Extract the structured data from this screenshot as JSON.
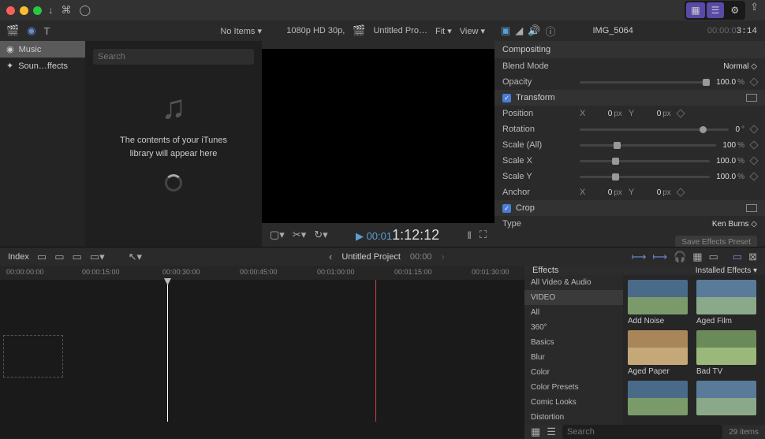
{
  "window": {
    "title": "IMG_5064",
    "timecode": "00:00:03:14"
  },
  "toolbar": {
    "no_items": "No Items ▾",
    "format": "1080p HD 30p,",
    "project": "Untitled Pro…",
    "fit": "Fit ▾",
    "view": "View ▾"
  },
  "sidebar": {
    "items": [
      {
        "label": "Music",
        "icon": "music-icon"
      },
      {
        "label": "Soun…ffects",
        "icon": "sparkle-icon"
      }
    ]
  },
  "browser": {
    "search_ph": "Search",
    "msg_l1": "The contents of your iTunes",
    "msg_l2": "library will appear here"
  },
  "viewer": {
    "timecode_prefix": "▶ 00:01",
    "timecode_main": "1:12:12"
  },
  "inspector": {
    "compositing": "Compositing",
    "blend": {
      "label": "Blend Mode",
      "value": "Normal ◇"
    },
    "opacity": {
      "label": "Opacity",
      "value": "100.0",
      "unit": "%"
    },
    "transform": "Transform",
    "position": {
      "label": "Position",
      "x": "0",
      "y": "0",
      "unit": "px"
    },
    "rotation": {
      "label": "Rotation",
      "value": "0",
      "unit": "°"
    },
    "scale_all": {
      "label": "Scale (All)",
      "value": "100",
      "unit": "%"
    },
    "scale_x": {
      "label": "Scale X",
      "value": "100.0",
      "unit": "%"
    },
    "scale_y": {
      "label": "Scale Y",
      "value": "100.0",
      "unit": "%"
    },
    "anchor": {
      "label": "Anchor",
      "x": "0",
      "y": "0",
      "unit": "px"
    },
    "crop": "Crop",
    "type": {
      "label": "Type",
      "value": "Ken Burns ◇"
    },
    "save": "Save Effects Preset"
  },
  "timeline": {
    "index": "Index",
    "project": "Untitled Project",
    "tc": "00:00",
    "ticks": [
      "00:00:00:00",
      "00:00:15:00",
      "00:00:30:00",
      "00:00:45:00",
      "00:01:00:00",
      "00:01:15:00",
      "00:01:30:00"
    ]
  },
  "effects": {
    "title": "Effects",
    "installed": "Installed Effects ▾",
    "cats": [
      "All Video & Audio",
      "VIDEO",
      "All",
      "360°",
      "Basics",
      "Blur",
      "Color",
      "Color Presets",
      "Comic Looks",
      "Distortion"
    ],
    "items": [
      {
        "name": "Add Noise",
        "c1": "#4a6a8a",
        "c2": "#7a9a6a"
      },
      {
        "name": "Aged Film",
        "c1": "#5a7a9a",
        "c2": "#8aa88a"
      },
      {
        "name": "Aged Paper",
        "c1": "#a8865a",
        "c2": "#c4a878"
      },
      {
        "name": "Bad TV",
        "c1": "#6a8a5a",
        "c2": "#9ab87a"
      },
      {
        "name": "",
        "c1": "#4a6a8a",
        "c2": "#7a9a6a"
      },
      {
        "name": "",
        "c1": "#5a7a9a",
        "c2": "#8aa88a"
      }
    ],
    "search_ph": "Search",
    "count": "29 items"
  }
}
